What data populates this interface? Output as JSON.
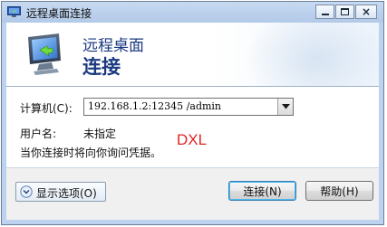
{
  "window": {
    "title": "远程桌面连接",
    "icon": "remote-desktop-icon"
  },
  "caption_buttons": {
    "minimize": "minimize-icon",
    "maximize": "maximize-icon",
    "close": "×"
  },
  "banner": {
    "line1": "远程桌面",
    "line2": "连接"
  },
  "form": {
    "computer_label": "计算机(C):",
    "computer_value": "192.168.1.2:12345 /admin",
    "username_label": "用户名:",
    "username_value": "未指定",
    "info_text": "当你连接时将向你询问凭据。"
  },
  "watermark": "DXL",
  "footer": {
    "options_label": "显示选项(O)",
    "connect_label": "连接(N)",
    "help_label": "帮助(H)"
  },
  "colors": {
    "accent": "#1b3a80",
    "watermark": "#e02424",
    "window_frame": "#bcd2ee"
  }
}
